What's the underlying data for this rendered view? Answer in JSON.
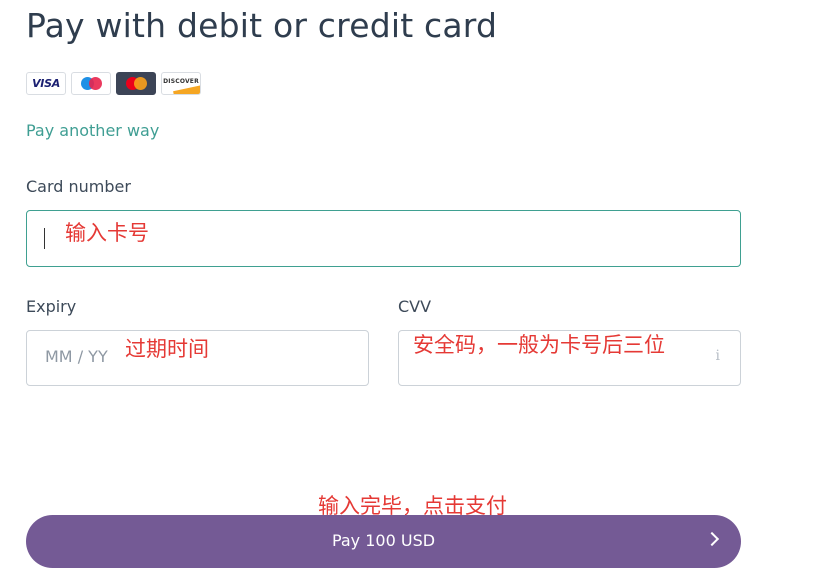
{
  "header": {
    "title": "Pay with debit or credit card"
  },
  "card_brands": [
    {
      "name": "VISA",
      "icon": "visa-icon"
    },
    {
      "name": "Maestro",
      "icon": "maestro-icon"
    },
    {
      "name": "Mastercard",
      "icon": "mastercard-icon"
    },
    {
      "name": "DISCOVER",
      "icon": "discover-icon"
    }
  ],
  "alt_link": "Pay another way",
  "form": {
    "card_number": {
      "label": "Card number",
      "value": "",
      "annotation": "输入卡号"
    },
    "expiry": {
      "label": "Expiry",
      "placeholder": "MM / YY",
      "annotation": "过期时间"
    },
    "cvv": {
      "label": "CVV",
      "info_icon": "i",
      "annotation": "安全码，一般为卡号后三位"
    }
  },
  "pay": {
    "label": "Pay 100 USD",
    "annotation": "输入完毕，点击支付"
  },
  "colors": {
    "title": "#2f3d4e",
    "link": "#3f9e93",
    "active_border": "#3fa091",
    "button": "#745a95",
    "annotation": "#e53935"
  }
}
